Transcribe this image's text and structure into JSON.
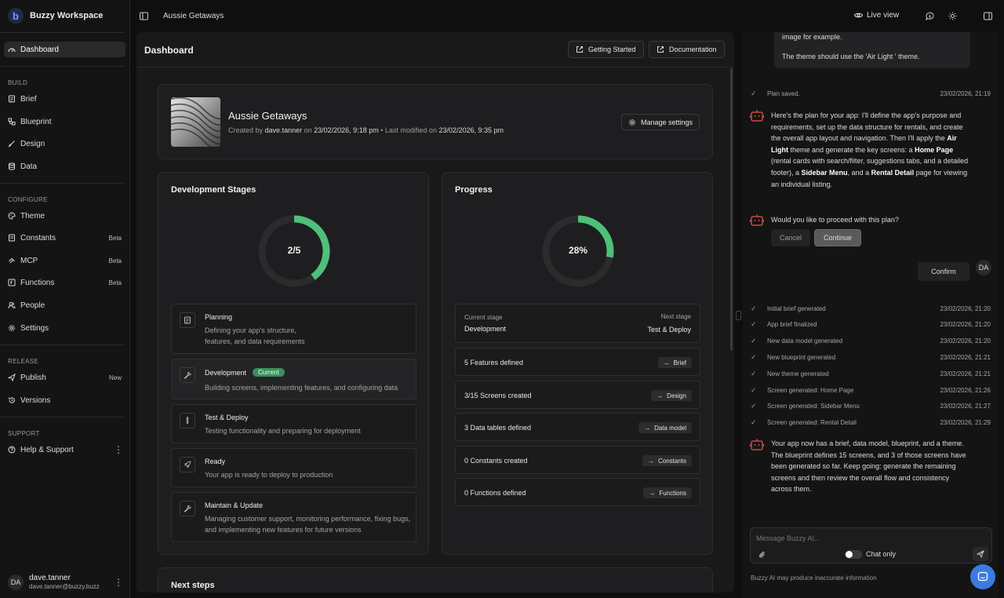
{
  "app": {
    "name": "Buzzy Workspace",
    "logo_letter": "b"
  },
  "sidebar": {
    "dashboard": "Dashboard",
    "sections": {
      "build": "BUILD",
      "configure": "CONFIGURE",
      "release": "RELEASE",
      "support": "SUPPORT"
    },
    "build_items": [
      {
        "label": "Brief",
        "icon": "document-icon"
      },
      {
        "label": "Blueprint",
        "icon": "blueprint-icon"
      },
      {
        "label": "Design",
        "icon": "brush-icon"
      },
      {
        "label": "Data",
        "icon": "database-icon"
      }
    ],
    "configure_items": [
      {
        "label": "Theme",
        "icon": "palette-icon"
      },
      {
        "label": "Constants",
        "badge": "Beta",
        "icon": "constants-icon"
      },
      {
        "label": "MCP",
        "badge": "Beta",
        "icon": "mcp-icon"
      },
      {
        "label": "Functions",
        "badge": "Beta",
        "icon": "function-icon"
      },
      {
        "label": "People",
        "icon": "people-icon"
      },
      {
        "label": "Settings",
        "icon": "gear-icon"
      }
    ],
    "release_items": [
      {
        "label": "Publish",
        "badge": "New",
        "icon": "publish-icon"
      },
      {
        "label": "Versions",
        "icon": "history-icon"
      }
    ],
    "support_items": [
      {
        "label": "Help & Support",
        "icon": "help-icon"
      }
    ],
    "user": {
      "initials": "DA",
      "name": "dave.tanner",
      "email": "dave.tanner@buzzy.buzz"
    }
  },
  "topbar": {
    "breadcrumb": "Aussie Getaways",
    "live_view": "Live view"
  },
  "main": {
    "title": "Dashboard",
    "getting_started": "Getting Started",
    "documentation": "Documentation",
    "project": {
      "name": "Aussie Getaways",
      "created_by_label": "Created by",
      "created_by": "dave.tanner",
      "on": "on",
      "created_on": "23/02/2026, 9:18 pm",
      "separator": "•",
      "last_modified_label": "Last modified on",
      "last_modified": "23/02/2026, 9:35 pm",
      "manage_settings": "Manage settings"
    },
    "stages_card": {
      "title": "Development Stages",
      "label": "2/5",
      "completed": 2,
      "total": 5,
      "stages": [
        {
          "title": "Planning",
          "desc": "Defining your app's structure, features, and data requirements",
          "icon": "document-icon"
        },
        {
          "title": "Development",
          "badge": "Current",
          "desc": "Building screens, implementing features, and configuring data",
          "icon": "wrench-icon"
        },
        {
          "title": "Test & Deploy",
          "desc": "Testing functionality and preparing for deployment",
          "icon": "test-tube-icon"
        },
        {
          "title": "Ready",
          "desc": "Your app is ready to deploy to production",
          "icon": "rocket-icon"
        },
        {
          "title": "Maintain & Update",
          "desc": "Managing customer support, monitoring performance, fixing bugs, and implementing new features for future versions",
          "icon": "tools-icon"
        }
      ]
    },
    "progress_card": {
      "title": "Progress",
      "label": "28%",
      "percent": 28,
      "current_stage_label": "Current stage",
      "current_stage": "Development",
      "next_stage_label": "Next stage",
      "next_stage": "Test & Deploy",
      "rows": [
        {
          "label": "5 Features defined",
          "action": "Brief"
        },
        {
          "label": "3/15 Screens created",
          "action": "Design"
        },
        {
          "label": "3 Data tables defined",
          "action": "Data model"
        },
        {
          "label": "0 Constants created",
          "action": "Constants"
        },
        {
          "label": "0 Functions defined",
          "action": "Functions"
        }
      ]
    },
    "next_steps": "Next steps"
  },
  "chat": {
    "user_msg_line1": "image for example.",
    "user_msg_line2": "The theme should use the 'Air Light ' theme.",
    "log1": {
      "text": "Plan saved.",
      "date": "23/02/2026, 21:19"
    },
    "plan": {
      "p1": "Here's the plan for your app: I'll define the app's purpose and requirements, set up the data structure for rentals, and create the overall app layout and navigation. Then I'll apply the ",
      "b1": "Air Light",
      "p2": " theme and generate the key screens: a ",
      "b2": "Home Page",
      "p3": " (rental cards with search/filter, suggestions tabs, and a detailed footer), a ",
      "b3": "Sidebar Menu",
      "p4": ", and a ",
      "b4": "Rental Detail",
      "p5": " page for viewing an individual listing."
    },
    "question": "Would you like to proceed with this plan?",
    "cancel": "Cancel",
    "continue": "Continue",
    "confirm": "Confirm",
    "user_initials": "DA",
    "logs": [
      {
        "text": "Initial brief generated",
        "date": "23/02/2026, 21:20"
      },
      {
        "text": "App brief finalized",
        "date": "23/02/2026, 21:20"
      },
      {
        "text": "New data model generated",
        "date": "23/02/2026, 21:20"
      },
      {
        "text": "New blueprint generated",
        "date": "23/02/2026, 21:21"
      },
      {
        "text": "New theme generated",
        "date": "23/02/2026, 21:21"
      },
      {
        "text": "Screen generated: Home Page",
        "date": "23/02/2026, 21:26"
      },
      {
        "text": "Screen generated: Sidebar Menu",
        "date": "23/02/2026, 21:27"
      },
      {
        "text": "Screen generated: Rental Detail",
        "date": "23/02/2026, 21:29"
      }
    ],
    "summary": "Your app now has a brief, data model, blueprint, and a theme. The blueprint defines 15 screens, and 3 of those screens have been generated so far. Keep going: generate the remaining screens and then review the overall flow and consistency across them.",
    "input_placeholder": "Message Buzzy AI...",
    "chat_only": "Chat only",
    "disclaimer": "Buzzy AI may produce inaccurate information"
  },
  "colors": {
    "accent_green": "#4fbf7a",
    "fab_blue": "#3b7be0",
    "bot_orange": "#e8583a",
    "bot_pink": "#e0408a"
  }
}
